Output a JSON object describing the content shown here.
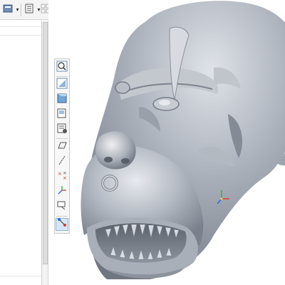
{
  "top_toolbar": {
    "buttons": [
      {
        "name": "regenerate",
        "icon": "regenerate-icon"
      },
      {
        "name": "list",
        "icon": "list-icon"
      },
      {
        "name": "grid",
        "icon": "grid-settings-icon"
      }
    ]
  },
  "view_toolbar": {
    "tools": [
      {
        "name": "zoom-in",
        "icon": "zoom-in-icon"
      },
      {
        "name": "refit",
        "icon": "refit-icon"
      },
      {
        "name": "display-style",
        "icon": "display-style-icon"
      },
      {
        "name": "saved-views",
        "icon": "saved-views-icon"
      },
      {
        "name": "view-manager",
        "icon": "view-manager-icon"
      },
      {
        "name": "plane-display",
        "icon": "plane-display-icon"
      },
      {
        "name": "axis-display",
        "icon": "axis-display-icon"
      },
      {
        "name": "point-display",
        "icon": "point-display-icon"
      },
      {
        "name": "csys-display",
        "icon": "csys-display-icon"
      },
      {
        "name": "annotation-display",
        "icon": "annotation-display-icon"
      },
      {
        "name": "spin-center",
        "icon": "spin-center-icon"
      }
    ],
    "active_tool": "spin-center"
  },
  "colors": {
    "model": "#9ba1ab",
    "toolbar_bg": "#f7f7f7",
    "active_highlight": "#d7e6f5",
    "csys_x": "#e03a3a",
    "csys_y": "#2fb34a",
    "csys_z": "#2f68d8"
  }
}
